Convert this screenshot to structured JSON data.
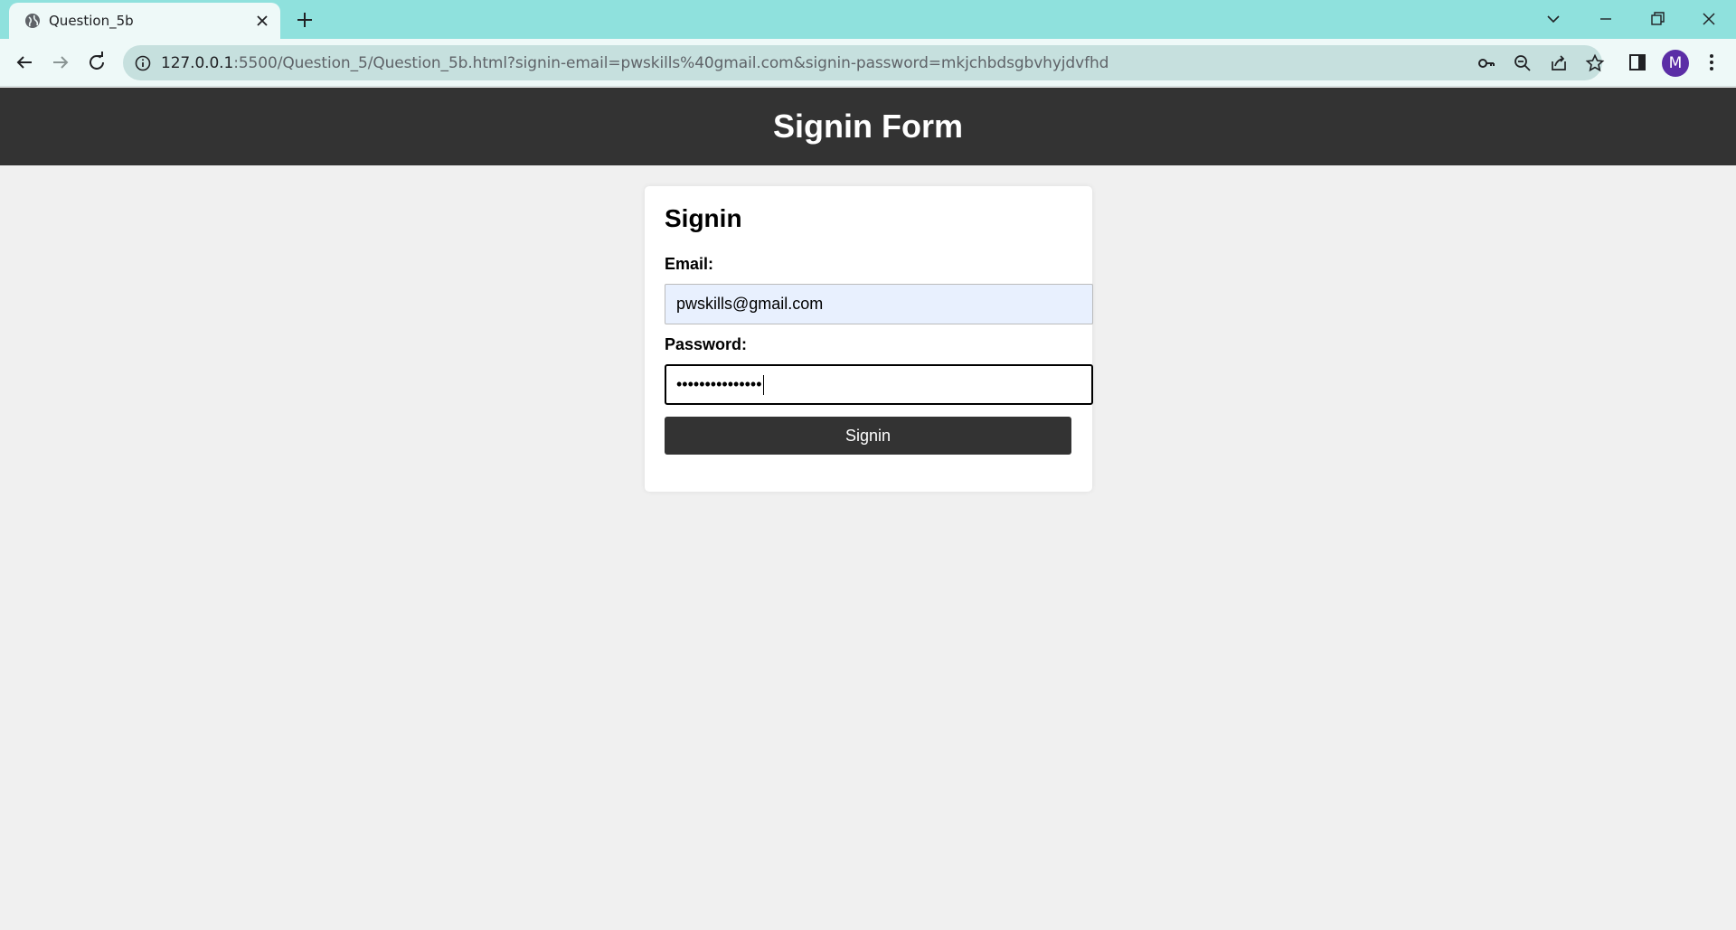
{
  "browser": {
    "tab_title": "Question_5b",
    "url_host": "127.0.0.1",
    "url_rest": ":5500/Question_5/Question_5b.html?signin-email=pwskills%40gmail.com&signin-password=mkjchbdsgbvhyjdvfhd",
    "profile_initial": "M",
    "tab_bar_color": "#8fe1dd",
    "toolbar_color": "#eef9f8"
  },
  "header": {
    "title": "Signin Form"
  },
  "form": {
    "title": "Signin",
    "email_label": "Email:",
    "email_value": "pwskills@gmail.com",
    "password_label": "Password:",
    "password_masked": "•••••••••••••••",
    "submit_label": "Signin"
  },
  "colors": {
    "header_bg": "#333333",
    "page_bg": "#f0f0f0",
    "autofill_bg": "#e8f0fe"
  },
  "icons": [
    "globe-icon",
    "close-icon",
    "plus-icon",
    "chevron-down-icon",
    "minimize-icon",
    "restore-icon",
    "back-icon",
    "forward-icon",
    "reload-icon",
    "info-icon",
    "key-icon",
    "zoom-out-icon",
    "share-icon",
    "star-icon",
    "sidebar-icon",
    "kebab-menu-icon"
  ]
}
